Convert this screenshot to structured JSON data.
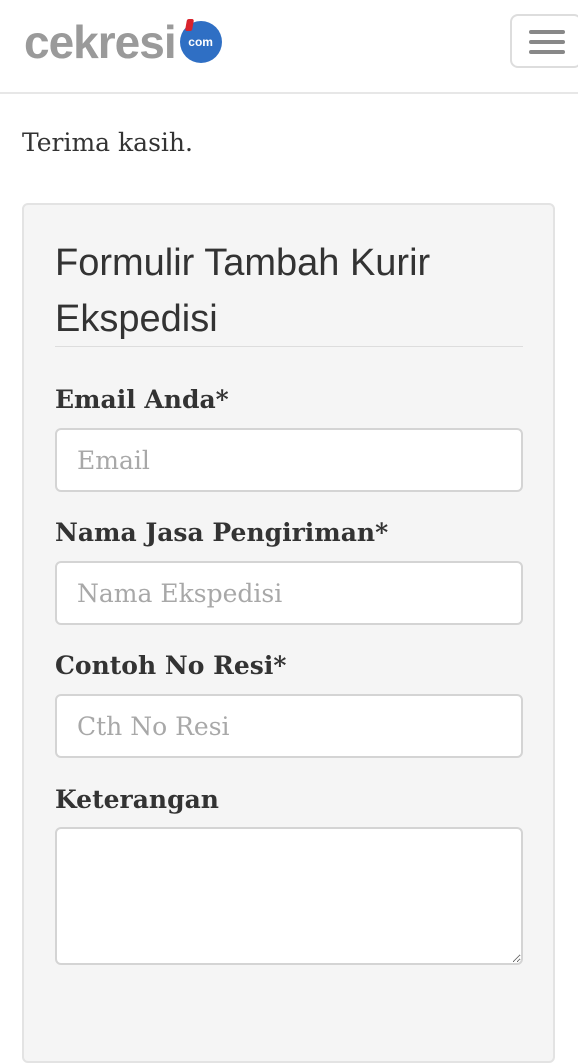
{
  "header": {
    "logo_text": "cekresi",
    "logo_badge": "com",
    "menu_icon": "hamburger-menu-icon"
  },
  "main": {
    "intro_text": "Terima kasih.",
    "form": {
      "title": "Formulir Tambah Kurir Ekspedisi",
      "fields": [
        {
          "label": "Email Anda*",
          "placeholder": "Email",
          "value": ""
        },
        {
          "label": "Nama Jasa Pengiriman*",
          "placeholder": "Nama Ekspedisi",
          "value": ""
        },
        {
          "label": "Contoh No Resi*",
          "placeholder": "Cth No Resi",
          "value": ""
        },
        {
          "label": "Keterangan",
          "placeholder": "",
          "value": ""
        }
      ]
    }
  },
  "colors": {
    "logo_gray": "#9a9a9a",
    "logo_red": "#d9232d",
    "logo_blue": "#2f6fc4",
    "card_bg": "#f5f5f5"
  }
}
